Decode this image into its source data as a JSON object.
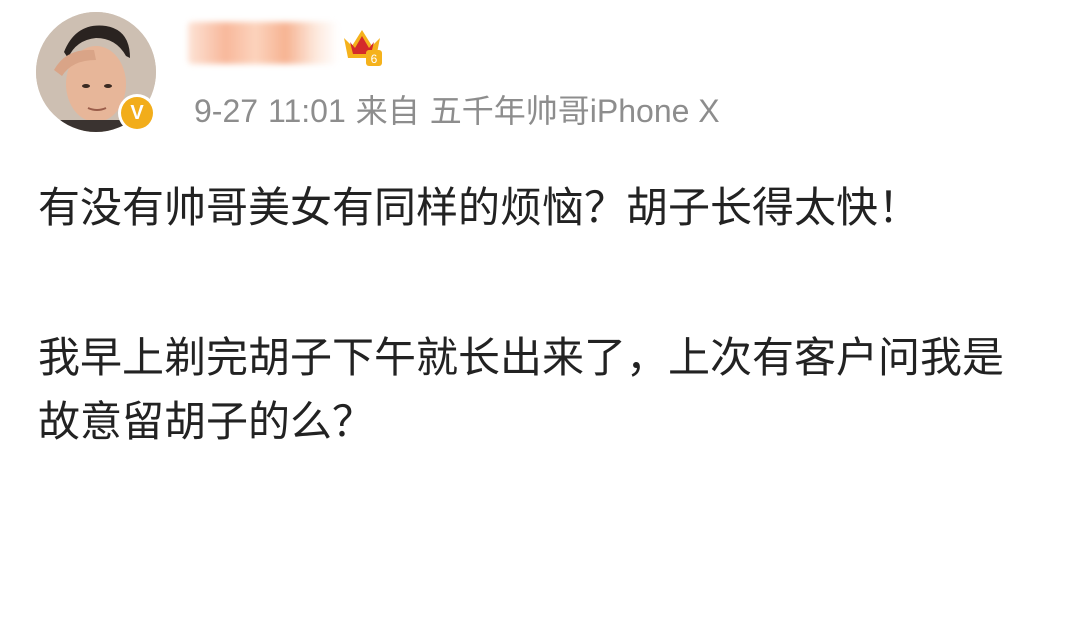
{
  "post": {
    "author": {
      "avatar": "user-avatar-photo",
      "verified_icon": "verified-v-badge",
      "verified_mark": "V",
      "vip_icon": "vip-crown-icon",
      "vip_level": "6",
      "name_hidden": true
    },
    "meta": {
      "date": "9-27",
      "time": "11:01",
      "source_prefix": "来自",
      "source": "五千年帅哥iPhone X"
    },
    "paragraphs": [
      "有没有帅哥美女有同样的烦恼？胡子长得太快！",
      "我早上剃完胡子下午就长出来了，上次有客户问我是故意留胡子的么？"
    ]
  },
  "colors": {
    "background": "#ffffff",
    "meta_text": "#8d8d8d",
    "body_text": "#222222",
    "verified": "#f2ad1b",
    "vip_red": "#d42b2b",
    "vip_gold": "#f5b21c"
  }
}
